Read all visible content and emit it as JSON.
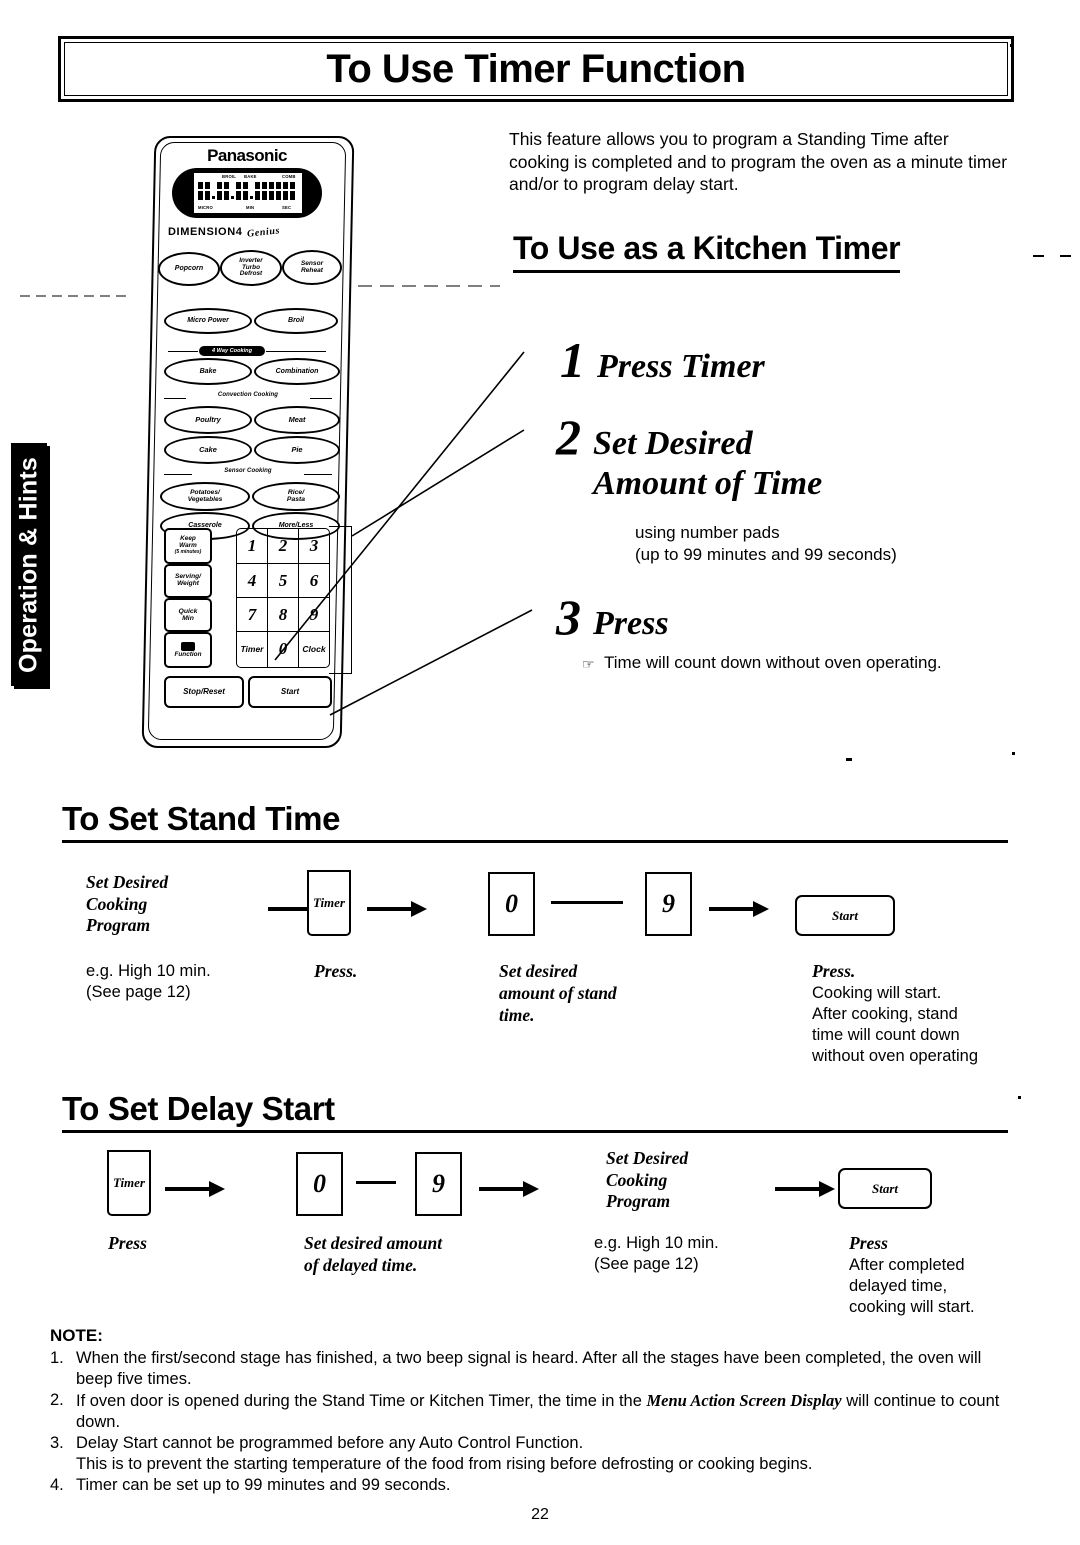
{
  "page": {
    "title": "To Use Timer Function",
    "page_number": "22",
    "side_tab": "Operation & Hints",
    "intro": "This feature allows you to program a Standing Time after cooking is completed and to program the oven as a minute timer and/or to program delay start."
  },
  "kitchen_timer": {
    "heading": "To Use as a Kitchen Timer",
    "steps": [
      {
        "num": "1",
        "text": "Press Timer",
        "sub": ""
      },
      {
        "num": "2",
        "text": "Set Desired\nAmount of Time",
        "sub": "using number pads\n(up to 99 minutes and 99 seconds)"
      },
      {
        "num": "3",
        "text": "Press",
        "sub": "Time will count down without oven operating."
      }
    ],
    "step1_text": "Press Timer",
    "step2_line1": "Set Desired",
    "step2_line2": "Amount of Time",
    "step2_sub_line1": "using number pads",
    "step2_sub_line2": "(up to 99 minutes and 99 seconds)",
    "step3_text": "Press",
    "step3_bullet": "Time will count down without oven operating."
  },
  "control_panel": {
    "brand": "Panasonic",
    "display": {
      "top_labels": [
        "BROIL",
        "BAKE",
        "COMB"
      ],
      "bottom_labels": [
        "MICRO",
        "MIN",
        "SEC"
      ]
    },
    "model_line": "DIMENSION4",
    "model_script": "Genius",
    "row_popcorn": [
      "Popcorn",
      "Inverter\nTurbo\nDefrost",
      "Sensor\nReheat"
    ],
    "popcorn": "Popcorn",
    "inverter": "Inverter Turbo Defrost",
    "inverter_l1": "Inverter",
    "inverter_l2": "Turbo",
    "inverter_l3": "Defrost",
    "sensor_reheat_l1": "Sensor",
    "sensor_reheat_l2": "Reheat",
    "micro_power": "Micro Power",
    "broil": "Broil",
    "four_way_cooking": "4 Way Cooking",
    "bake": "Bake",
    "combination": "Combination",
    "convection_cooking": "Convection Cooking",
    "poultry": "Poultry",
    "meat": "Meat",
    "cake": "Cake",
    "pie": "Pie",
    "sensor_cooking": "Sensor Cooking",
    "potatoes_l1": "Potatoes/",
    "potatoes_l2": "Vegetables",
    "rice_l1": "Rice/",
    "rice_l2": "Pasta",
    "casserole": "Casserole",
    "more_less": "More/Less",
    "keep_warm_l1": "Keep",
    "keep_warm_l2": "Warm",
    "keep_warm_l3": "(5 minutes)",
    "serving_l1": "Serving/",
    "serving_l2": "Weight",
    "quick_l1": "Quick",
    "quick_l2": "Min",
    "function": "Function",
    "numpad": [
      "1",
      "2",
      "3",
      "4",
      "5",
      "6",
      "7",
      "8",
      "9"
    ],
    "timer_key": "Timer",
    "zero_key": "0",
    "clock_key": "Clock",
    "stop_reset": "Stop/Reset",
    "start": "Start"
  },
  "stand_time": {
    "heading": "To Set Stand Time",
    "flow": {
      "step1_l1": "Set Desired",
      "step1_l2": "Cooking",
      "step1_l3": "Program",
      "timer": "Timer",
      "range_from": "0",
      "range_to": "9",
      "start": "Start"
    },
    "captions": [
      {
        "bold": "",
        "lines": [
          "e.g. High 10 min.",
          "(See page 12)"
        ]
      },
      {
        "bold": "Press.",
        "lines": []
      },
      {
        "bold": "Set desired\namount of stand\ntime.",
        "lines": []
      },
      {
        "bold": "Press.",
        "lines": [
          "Cooking will start.",
          "After cooking, stand",
          "time will count down",
          "without oven operating"
        ]
      }
    ],
    "cap1_l1": "e.g. High 10 min.",
    "cap1_l2": "(See page 12)",
    "cap2_b": "Press.",
    "cap3_b1": "Set desired",
    "cap3_b2": "amount of stand",
    "cap3_b3": "time.",
    "cap4_b": "Press.",
    "cap4_l1": "Cooking will start.",
    "cap4_l2": "After cooking, stand",
    "cap4_l3": "time will count down",
    "cap4_l4": "without oven operating"
  },
  "delay_start": {
    "heading": "To Set Delay Start",
    "flow": {
      "timer": "Timer",
      "range_from": "0",
      "range_to": "9",
      "step3_l1": "Set Desired",
      "step3_l2": "Cooking",
      "step3_l3": "Program",
      "start": "Start"
    },
    "cap1_b": "Press",
    "cap2_b1": "Set desired amount",
    "cap2_b2": "of delayed time.",
    "cap3_l1": "e.g. High 10 min.",
    "cap3_l2": "(See page 12)",
    "cap4_b": "Press",
    "cap4_l1": "After completed",
    "cap4_l2": "delayed time,",
    "cap4_l3": "cooking will start."
  },
  "notes": {
    "heading": "NOTE:",
    "items": [
      {
        "n": "1.",
        "text": "When the first/second stage has finished, a two beep signal is heard. After all the stages have been completed, the oven will beep five times."
      },
      {
        "n": "2.",
        "pre": "If oven door is opened during the Stand Time or Kitchen Timer, the time in the ",
        "em": "Menu Action Screen Display",
        "post": " will continue to count down."
      },
      {
        "n": "3.",
        "text": "Delay Start cannot be programmed before any Auto Control Function. This is to prevent the starting temperature of the food from rising before defrosting or cooking begins."
      },
      {
        "n": "4.",
        "text": "Timer can be set up to 99 minutes and 99 seconds."
      }
    ],
    "n1": "1.",
    "n1_text": "When the first/second stage has finished, a two beep signal is heard. After all the stages have been completed, the oven will beep five times.",
    "n2": "2.",
    "n2_pre": "If oven door is opened during the Stand Time or Kitchen Timer, the time in the ",
    "n2_em": "Menu Action Screen Display",
    "n2_post": " will continue to count down.",
    "n3": "3.",
    "n3_text": "Delay Start cannot be programmed before any Auto Control Function.",
    "n3_text2": "This is to prevent the starting temperature of the food from rising before defrosting or cooking begins.",
    "n4": "4.",
    "n4_text": "Timer can be set up to 99 minutes and 99 seconds."
  }
}
